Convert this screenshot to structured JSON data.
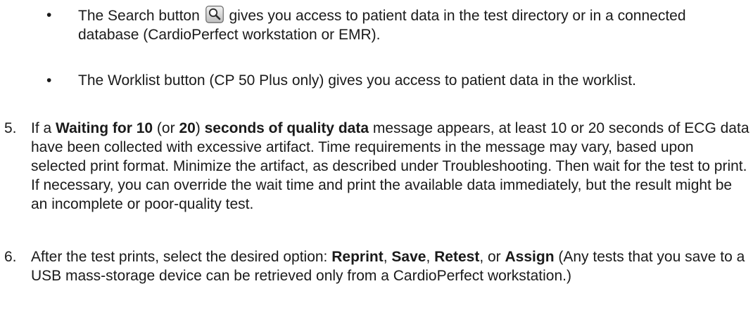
{
  "bullets": [
    {
      "symbol": "•",
      "before_icon": "The Search button",
      "icon": "search-icon",
      "after_icon": "gives you access to patient data in the test directory or in a connected database (CardioPerfect workstation or EMR)."
    },
    {
      "symbol": "•",
      "text": "The Worklist button (CP 50 Plus only) gives you access to patient data in the worklist."
    }
  ],
  "steps": [
    {
      "number": "5.",
      "p1": "If a ",
      "b1": "Waiting for 10",
      "p2": " (or ",
      "b2": "20",
      "p3": ") ",
      "b3": "seconds of quality data",
      "p4": " message appears, at least 10 or 20 seconds of ECG data have been collected with excessive artifact. Time requirements in the message may vary, based upon selected print format. Minimize the artifact, as described under Troubleshooting. Then wait for the test to print. If necessary, you can override the wait time and print the available data immediately, but the result might be an incomplete or poor-quality test."
    },
    {
      "number": "6.",
      "p1": "After the test prints, select the desired option: ",
      "b1": "Reprint",
      "p2": ", ",
      "b2": "Save",
      "p3": ", ",
      "b3": "Retest",
      "p4": ", or ",
      "b4": "Assign",
      "p5": " (Any tests that you save to a USB mass-storage device can be retrieved only from a CardioPerfect workstation.)"
    }
  ]
}
